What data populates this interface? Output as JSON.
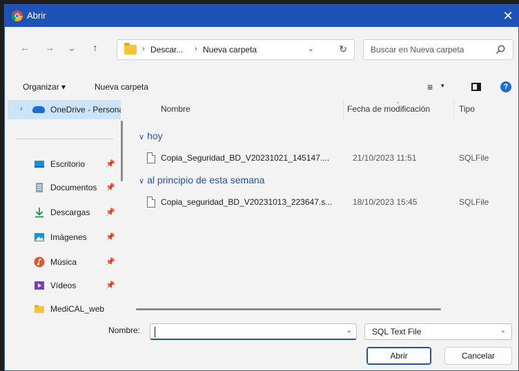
{
  "window": {
    "title": "Abrir",
    "close_glyph": "✕"
  },
  "nav": {
    "back": "←",
    "forward": "→",
    "recent": "⌄",
    "up": "↑"
  },
  "address": {
    "crumbs": [
      "Descar...",
      "Nueva carpeta"
    ],
    "separator": "›",
    "dropdown": "⌄",
    "refresh": "↻"
  },
  "search": {
    "placeholder": "Buscar en Nueva carpeta"
  },
  "toolbar": {
    "organize_label": "Organizar ▾",
    "new_folder_label": "Nueva carpeta",
    "view_glyph": "≡",
    "view_dd": "▾",
    "help_glyph": "?"
  },
  "sidebar": {
    "onedrive_label": "OneDrive - Personal",
    "expander": "›",
    "pin_glyph": "📌",
    "items": [
      {
        "label": "Escritorio",
        "icon": "desktop-icon",
        "pinned": true
      },
      {
        "label": "Documentos",
        "icon": "documents-icon",
        "pinned": true
      },
      {
        "label": "Descargas",
        "icon": "downloads-icon",
        "pinned": true
      },
      {
        "label": "Imágenes",
        "icon": "pictures-icon",
        "pinned": true
      },
      {
        "label": "Música",
        "icon": "music-icon",
        "pinned": true
      },
      {
        "label": "Vídeos",
        "icon": "videos-icon",
        "pinned": true
      },
      {
        "label": "MediCAL_web",
        "icon": "folder-icon",
        "pinned": false
      }
    ]
  },
  "filelist": {
    "columns": {
      "name": "Nombre",
      "date": "Fecha de modificación",
      "type": "Tipo"
    },
    "groups": [
      {
        "label": "hoy",
        "files": [
          {
            "name": "Copia_Seguridad_BD_V20231021_145147....",
            "date": "21/10/2023 11:51",
            "type": "SQLFile"
          }
        ]
      },
      {
        "label": "al principio de esta semana",
        "files": [
          {
            "name": "Copia_seguridad_BD_V20231013_223647.s...",
            "date": "18/10/2023 15:45",
            "type": "SQLFile"
          }
        ]
      }
    ]
  },
  "footer": {
    "name_label": "Nombre:",
    "name_value": "",
    "file_type": "SQL Text File",
    "dd_glyph": "⌄",
    "open_label": "Abrir",
    "cancel_label": "Cancelar"
  },
  "colors": {
    "accent": "#1f52b7",
    "selection": "#cce4f7",
    "folder": "#f6c43a"
  }
}
